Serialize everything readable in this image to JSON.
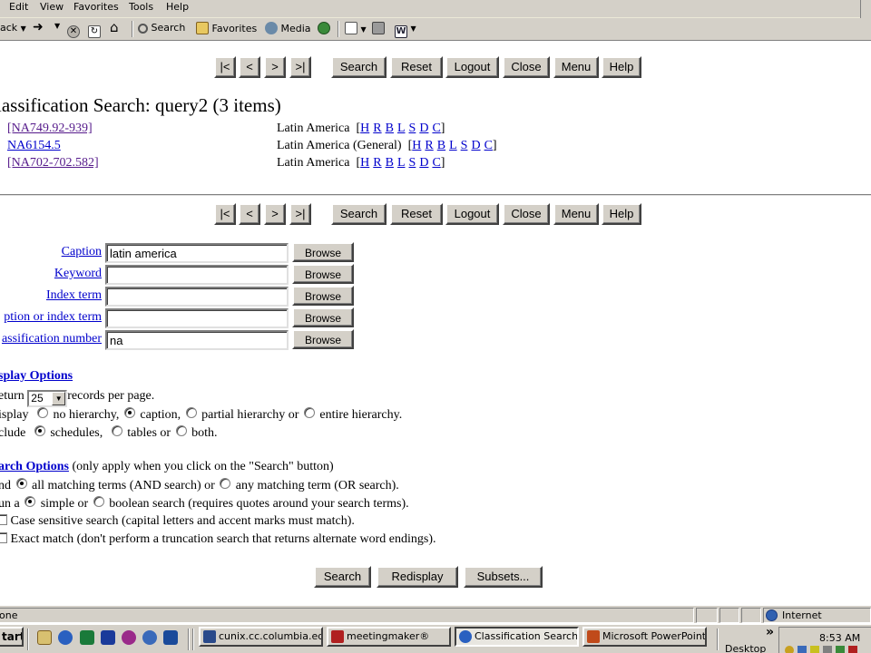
{
  "browser": {
    "menu": [
      "Edit",
      "View",
      "Favorites",
      "Tools",
      "Help"
    ],
    "toolbar": {
      "back": "ack",
      "search": "Search",
      "favorites": "Favorites",
      "media": "Media"
    }
  },
  "nav": {
    "first": "|<",
    "prev": "<",
    "next": ">",
    "last": ">|",
    "search": "Search",
    "reset": "Reset",
    "logout": "Logout",
    "close": "Close",
    "menu": "Menu",
    "help": "Help"
  },
  "results": {
    "title": "lassification Search: query2 (3 items)",
    "rows": [
      {
        "code": "[NA749.92-939]",
        "desc": "Latin America",
        "links": [
          "H",
          "R",
          "B",
          "L",
          "S",
          "D",
          "C"
        ]
      },
      {
        "code": "NA6154.5",
        "desc": "Latin America (General)",
        "links": [
          "H",
          "R",
          "B",
          "L",
          "S",
          "D",
          "C"
        ]
      },
      {
        "code": "[NA702-702.582]",
        "desc": "Latin America",
        "links": [
          "H",
          "R",
          "B",
          "L",
          "S",
          "D",
          "C"
        ]
      }
    ],
    "bracket_open": "[",
    "bracket_close": "]"
  },
  "form": {
    "fields": [
      {
        "label": "Caption",
        "value": "latin america"
      },
      {
        "label": "Keyword",
        "value": ""
      },
      {
        "label": "Index term",
        "value": ""
      },
      {
        "label": "ption or index term",
        "value": ""
      },
      {
        "label": "assification number",
        "value": "na"
      }
    ],
    "browse": "Browse"
  },
  "display_options": {
    "heading": "splay Options",
    "return_prefix": "eturn",
    "return_value": "25",
    "return_suffix": "records per page.",
    "display_prefix": "isplay",
    "display_choices": [
      "no hierarchy,",
      "caption,",
      "partial hierarchy or",
      "entire hierarchy."
    ],
    "display_selected": 1,
    "include_prefix": "clude",
    "include_choices": [
      "schedules,",
      "tables or",
      "both."
    ],
    "include_selected": 0
  },
  "search_options": {
    "heading": "arch Options",
    "note": "(only apply when you click on the \"Search\" button)",
    "find_prefix": "nd",
    "find_choices": [
      "all matching terms (AND search) or",
      "any matching term (OR search)."
    ],
    "find_selected": 0,
    "run_prefix": "un a",
    "run_choices": [
      "simple or",
      "boolean search (requires quotes around your search terms)."
    ],
    "run_selected": 0,
    "case_sensitive": "Case sensitive search (capital letters and accent marks must match).",
    "exact_match": "Exact match (don't perform a truncation search that returns alternate word endings)."
  },
  "bottom_buttons": {
    "search": "Search",
    "redisplay": "Redisplay",
    "subsets": "Subsets..."
  },
  "status": {
    "left": "one",
    "zone": "Internet"
  },
  "taskbar": {
    "start": "tart",
    "tasks": [
      "cunix.cc.columbia.ed...",
      "meetingmaker®",
      "Classification Search ...",
      "Microsoft PowerPoint..."
    ],
    "active_task": 2,
    "desktop": "Desktop",
    "chevron": "»",
    "clock": "8:53 AM"
  },
  "colors": {
    "chrome": "#d4d0c8",
    "link": "#0000cc",
    "visited": "#551a8b"
  }
}
